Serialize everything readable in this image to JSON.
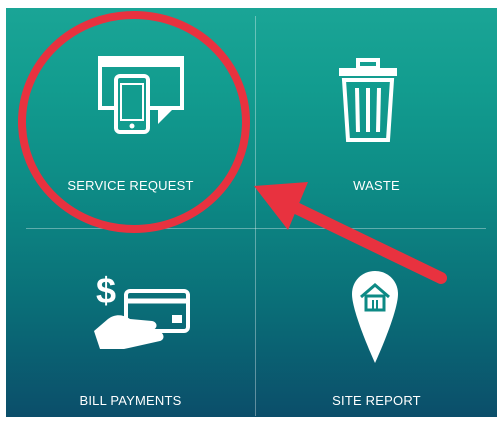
{
  "tiles": {
    "service_request": {
      "label": "SERVICE REQUEST",
      "icon": "devices-icon"
    },
    "waste": {
      "label": "WASTE",
      "icon": "trash-bin-icon"
    },
    "bill_payments": {
      "label": "BILL PAYMENTS",
      "icon": "hand-card-payment-icon"
    },
    "site_report": {
      "label": "SITE REPORT",
      "icon": "location-pin-house-icon"
    }
  },
  "annotation": {
    "circle_color": "#e8323f",
    "arrow_color": "#e8323f"
  },
  "colors": {
    "background_top": "#1aa596",
    "background_bottom": "#0b4e6a",
    "foreground": "#ffffff"
  }
}
